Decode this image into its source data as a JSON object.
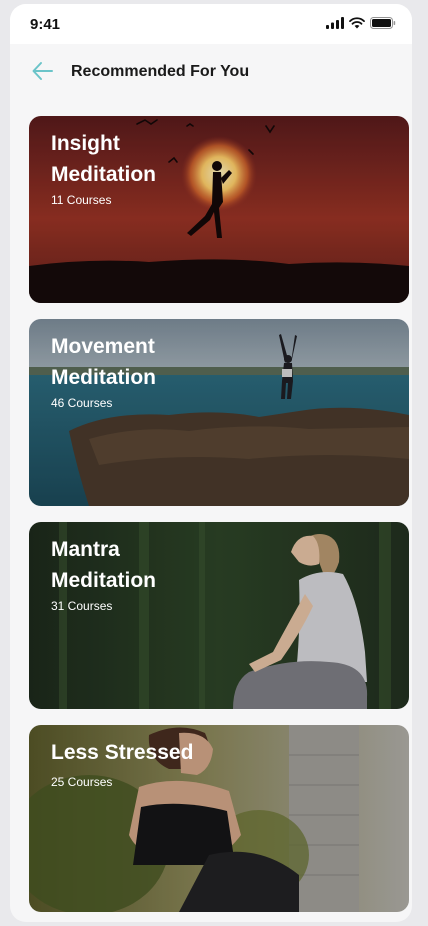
{
  "status_bar": {
    "time": "9:41",
    "icons": [
      "signal-icon",
      "wifi-icon",
      "battery-icon"
    ]
  },
  "header": {
    "back_icon": "arrow-left-icon",
    "title": "Recommended For You"
  },
  "colors": {
    "accent": "#6bc4c9",
    "background": "#f6f6f7"
  },
  "cards": [
    {
      "title": "Insight\nMeditation",
      "count": "11 Courses"
    },
    {
      "title": "Movement\nMeditation",
      "count": "46 Courses"
    },
    {
      "title": "Mantra\nMeditation",
      "count": "31 Courses"
    },
    {
      "title": "Less Stressed",
      "count": "25 Courses"
    }
  ]
}
